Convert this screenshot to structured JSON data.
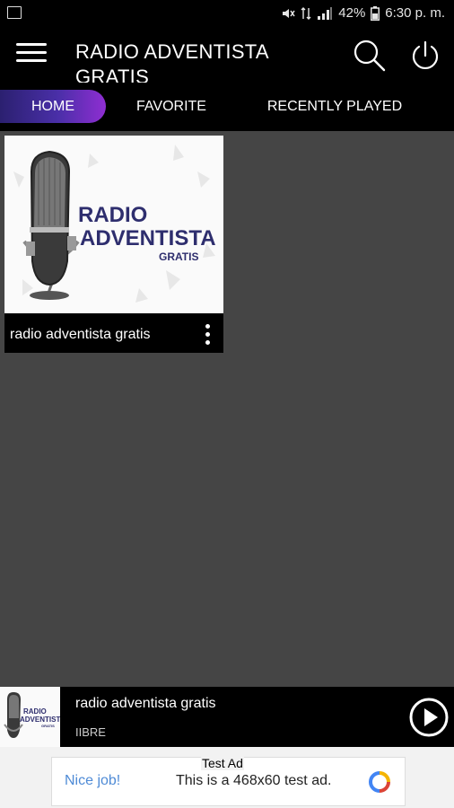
{
  "status_bar": {
    "battery_percent": "42%",
    "time": "6:30 p. m.",
    "icons": [
      "gallery-icon",
      "mute-icon",
      "data-icon",
      "signal-icon",
      "battery-icon"
    ]
  },
  "appbar": {
    "title": "RADIO ADVENTISTA GRATIS",
    "icons": [
      "menu-icon",
      "search-icon",
      "power-icon"
    ]
  },
  "tabs": [
    {
      "label": "HOME",
      "active": true
    },
    {
      "label": "FAVORITE",
      "active": false
    },
    {
      "label": "RECENTLY PLAYED",
      "active": false
    }
  ],
  "stations": [
    {
      "name": "radio adventista gratis",
      "logo": {
        "line1": "RADIO",
        "line2": "ADVENTISTA",
        "line3": "GRATIS"
      }
    }
  ],
  "player": {
    "title": "radio adventista gratis",
    "subtitle": "IIBRE",
    "logo": {
      "line1": "RADIO",
      "line2": "ADVENTISTA",
      "line3": "GRATIS"
    }
  },
  "ad": {
    "label": "Test Ad",
    "nice": "Nice job!",
    "text": "This is a 468x60 test ad."
  },
  "colors": {
    "background": "#454545",
    "bar": "#000000",
    "tab_gradient_start": "#2b2070",
    "tab_gradient_end": "#8f2ed2",
    "logo_text": "#2e2e6e"
  }
}
